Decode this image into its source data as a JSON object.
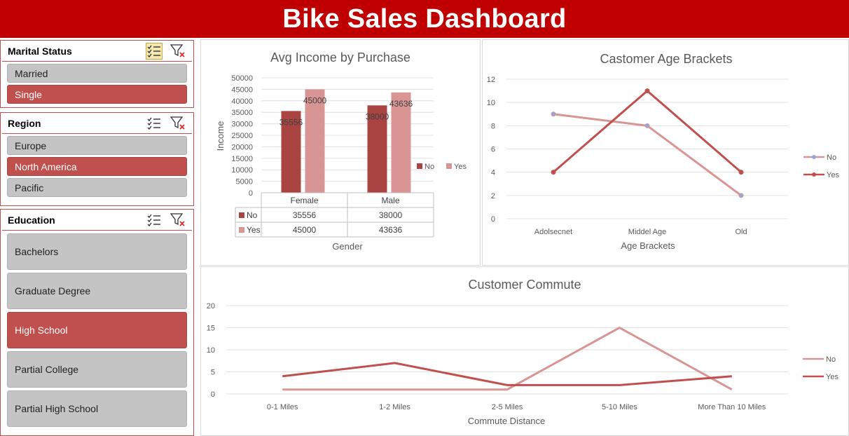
{
  "dashboard": {
    "title": "Bike Sales Dashboard"
  },
  "colors": {
    "header": "#c00000",
    "no": "#d99594",
    "yes": "#c0504d",
    "bar_no": "#a94442",
    "bar_yes": "#d99594",
    "selected": "#c0504d",
    "unselected": "#c4c4c4"
  },
  "slicers": {
    "marital": {
      "title": "Marital Status",
      "items": [
        {
          "label": "Married",
          "selected": false
        },
        {
          "label": "Single",
          "selected": true
        }
      ]
    },
    "region": {
      "title": "Region",
      "items": [
        {
          "label": "Europe",
          "selected": false
        },
        {
          "label": "North America",
          "selected": true
        },
        {
          "label": "Pacific",
          "selected": false
        }
      ]
    },
    "education": {
      "title": "Education",
      "items": [
        {
          "label": "Bachelors",
          "selected": false
        },
        {
          "label": "Graduate Degree",
          "selected": false
        },
        {
          "label": "High School",
          "selected": true
        },
        {
          "label": "Partial College",
          "selected": false
        },
        {
          "label": "Partial High School",
          "selected": false
        }
      ]
    }
  },
  "legend": {
    "no": "No",
    "yes": "Yes"
  },
  "chart_data": [
    {
      "type": "bar",
      "title": "Avg Income by Purchase",
      "xlabel": "Gender",
      "ylabel": "Income",
      "categories": [
        "Female",
        "Male"
      ],
      "series": [
        {
          "name": "No",
          "values": [
            35556,
            38000
          ]
        },
        {
          "name": "Yes",
          "values": [
            45000,
            43636
          ]
        }
      ],
      "ylim": [
        0,
        50000
      ],
      "yticks": [
        0,
        5000,
        10000,
        15000,
        20000,
        25000,
        30000,
        35000,
        40000,
        45000,
        50000
      ],
      "grid": true,
      "data_table": true,
      "legend": "right"
    },
    {
      "type": "line",
      "title": "Castomer Age Brackets",
      "xlabel": "Age Brackets",
      "ylabel": "",
      "categories": [
        "Adolsecnet",
        "Middel Age",
        "Old"
      ],
      "series": [
        {
          "name": "No",
          "values": [
            9,
            8,
            2
          ]
        },
        {
          "name": "Yes",
          "values": [
            4,
            11,
            4
          ]
        }
      ],
      "ylim": [
        0,
        12
      ],
      "yticks": [
        0,
        2,
        4,
        6,
        8,
        10,
        12
      ],
      "grid": true,
      "markers": true,
      "legend": "right"
    },
    {
      "type": "line",
      "title": "Customer Commute",
      "xlabel": "Commute Distance",
      "ylabel": "",
      "categories": [
        "0-1 Miles",
        "1-2 Miles",
        "2-5 Miles",
        "5-10 Miles",
        "More Than 10 Miles"
      ],
      "series": [
        {
          "name": "No",
          "values": [
            1,
            1,
            1,
            15,
            1
          ]
        },
        {
          "name": "Yes",
          "values": [
            4,
            7,
            2,
            2,
            4
          ]
        }
      ],
      "ylim": [
        0,
        20
      ],
      "yticks": [
        0,
        5,
        10,
        15,
        20
      ],
      "grid": true,
      "legend": "right"
    }
  ]
}
